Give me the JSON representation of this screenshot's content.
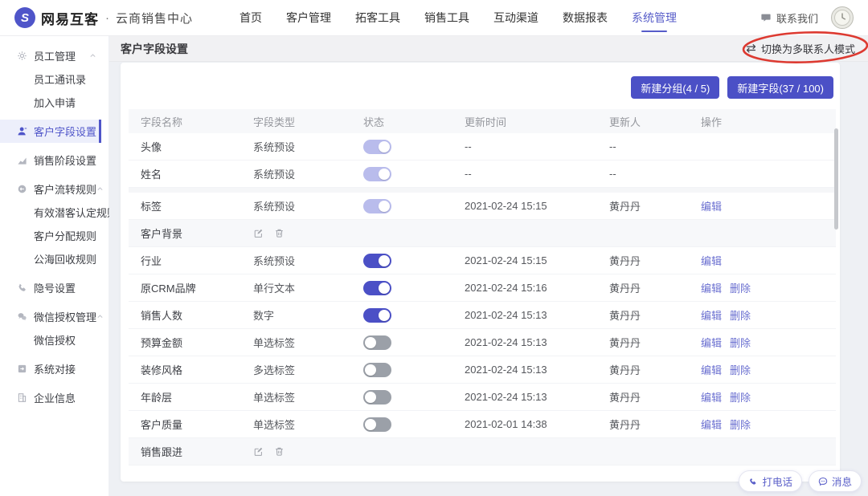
{
  "topnav": {
    "logo": {
      "brand": "网易互客",
      "separator": "·",
      "product": "云商销售中心"
    },
    "items": [
      {
        "label": "首页",
        "active": false
      },
      {
        "label": "客户管理",
        "active": false
      },
      {
        "label": "拓客工具",
        "active": false
      },
      {
        "label": "销售工具",
        "active": false
      },
      {
        "label": "互动渠道",
        "active": false
      },
      {
        "label": "数据报表",
        "active": false
      },
      {
        "label": "系统管理",
        "active": true
      }
    ],
    "contact_label": "联系我们"
  },
  "sidebar": {
    "items": [
      {
        "label": "员工管理",
        "icon": "gear-icon",
        "level": 0,
        "chevron": true
      },
      {
        "label": "员工通讯录",
        "level": 1
      },
      {
        "label": "加入申请",
        "level": 1
      },
      {
        "label": "客户字段设置",
        "icon": "user-icon",
        "level": 0,
        "active": true,
        "gap_before": true
      },
      {
        "label": "销售阶段设置",
        "icon": "chart-icon",
        "level": 0,
        "gap_before": true
      },
      {
        "label": "客户流转规则",
        "icon": "flow-icon",
        "level": 0,
        "chevron": true,
        "gap_before": true
      },
      {
        "label": "有效潜客认定规则",
        "level": 1
      },
      {
        "label": "客户分配规则",
        "level": 1
      },
      {
        "label": "公海回收规则",
        "level": 1
      },
      {
        "label": "隐号设置",
        "icon": "phone-icon",
        "level": 0,
        "gap_before": true
      },
      {
        "label": "微信授权管理",
        "icon": "wechat-icon",
        "level": 0,
        "chevron": true,
        "gap_before": true
      },
      {
        "label": "微信授权",
        "level": 1
      },
      {
        "label": "系统对接",
        "icon": "plug-icon",
        "level": 0,
        "gap_before": true
      },
      {
        "label": "企业信息",
        "icon": "building-icon",
        "level": 0,
        "gap_before": true
      }
    ]
  },
  "page": {
    "title": "客户字段设置",
    "mode_switch_label": "切换为多联系人模式"
  },
  "toolbar": {
    "new_group_label": "新建分组(4 / 5)",
    "new_field_label": "新建字段(37 / 100)"
  },
  "table": {
    "headers": [
      "字段名称",
      "字段类型",
      "状态",
      "更新时间",
      "更新人",
      "操作"
    ],
    "rows": [
      {
        "kind": "field",
        "name": "头像",
        "type": "系统预设",
        "toggle": "on-disabled",
        "updated_at": "--",
        "updated_by": "--",
        "actions": []
      },
      {
        "kind": "field",
        "name": "姓名",
        "type": "系统预设",
        "toggle": "on-disabled",
        "updated_at": "--",
        "updated_by": "--",
        "actions": []
      },
      {
        "kind": "field",
        "name": "标签",
        "type": "系统预设",
        "toggle": "on-disabled",
        "updated_at": "2021-02-24 15:15",
        "updated_by": "黄丹丹",
        "actions": [
          "编辑"
        ],
        "section_break": true
      },
      {
        "kind": "group",
        "name": "客户背景"
      },
      {
        "kind": "field",
        "name": "行业",
        "type": "系统预设",
        "toggle": "on",
        "updated_at": "2021-02-24 15:15",
        "updated_by": "黄丹丹",
        "actions": [
          "编辑"
        ]
      },
      {
        "kind": "field",
        "name": "原CRM品牌",
        "type": "单行文本",
        "toggle": "on",
        "updated_at": "2021-02-24 15:16",
        "updated_by": "黄丹丹",
        "actions": [
          "编辑",
          "删除"
        ]
      },
      {
        "kind": "field",
        "name": "销售人数",
        "type": "数字",
        "toggle": "on",
        "updated_at": "2021-02-24 15:13",
        "updated_by": "黄丹丹",
        "actions": [
          "编辑",
          "删除"
        ]
      },
      {
        "kind": "field",
        "name": "预算金额",
        "type": "单选标签",
        "toggle": "off",
        "updated_at": "2021-02-24 15:13",
        "updated_by": "黄丹丹",
        "actions": [
          "编辑",
          "删除"
        ]
      },
      {
        "kind": "field",
        "name": "装修风格",
        "type": "多选标签",
        "toggle": "off",
        "updated_at": "2021-02-24 15:13",
        "updated_by": "黄丹丹",
        "actions": [
          "编辑",
          "删除"
        ]
      },
      {
        "kind": "field",
        "name": "年龄层",
        "type": "单选标签",
        "toggle": "off",
        "updated_at": "2021-02-24 15:13",
        "updated_by": "黄丹丹",
        "actions": [
          "编辑",
          "删除"
        ]
      },
      {
        "kind": "field",
        "name": "客户质量",
        "type": "单选标签",
        "toggle": "off",
        "updated_at": "2021-02-01 14:38",
        "updated_by": "黄丹丹",
        "actions": [
          "编辑",
          "删除"
        ]
      },
      {
        "kind": "group",
        "name": "销售跟进"
      }
    ]
  },
  "float_buttons": {
    "call_label": "打电话",
    "message_label": "消息"
  },
  "colors": {
    "primary": "#4b50c6",
    "nav_active": "#575dc9",
    "link": "#6a6fd0",
    "toggle_on": "#4b50c6",
    "toggle_on_disabled": "#b9bcec",
    "toggle_off": "#9ba0a8",
    "annotation_red": "#dd3a31"
  }
}
